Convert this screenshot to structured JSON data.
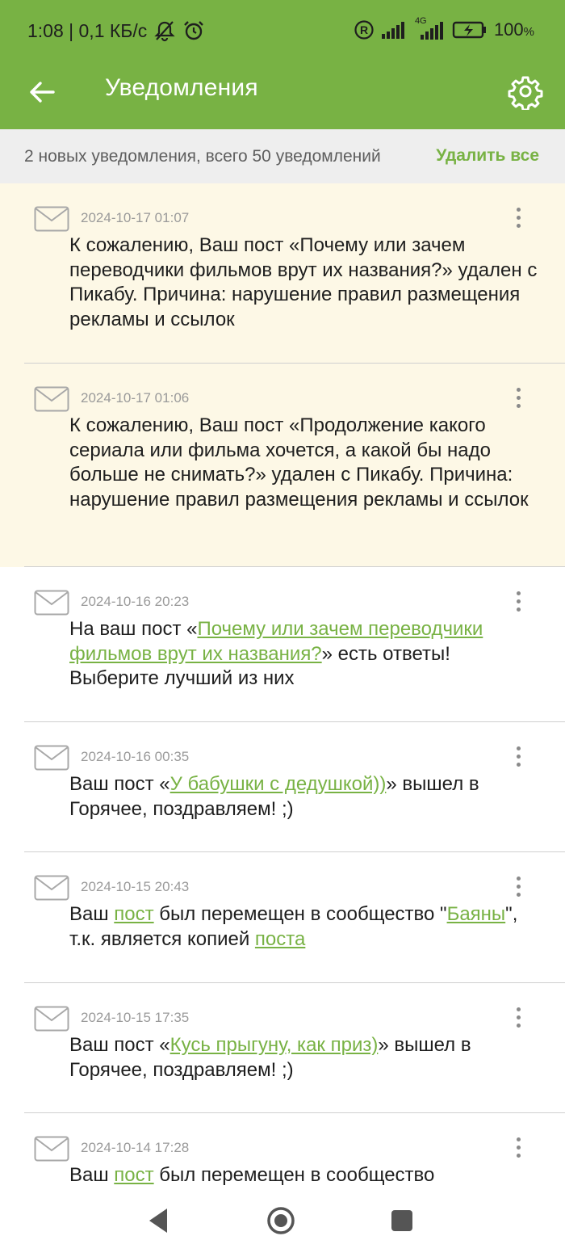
{
  "status_bar": {
    "left_text": "1:08 | 0,1 КБ/с",
    "network_label": "4G",
    "battery_percent": "100",
    "battery_unit": "%",
    "icons": [
      "muted-bell-icon",
      "alarm-icon",
      "registered-icon",
      "signal-icon",
      "signal-4g-icon",
      "battery-charging-icon"
    ]
  },
  "app_bar": {
    "title": "Уведомления",
    "icons": [
      "back-arrow-icon",
      "settings-gear-icon"
    ]
  },
  "summary": {
    "text": "2 новых уведомления, всего 50 уведомлений",
    "delete_all": "Удалить все"
  },
  "colors": {
    "brand_green": "#78b244",
    "unread_bg": "#fdf8e6",
    "summary_bg": "#eeeeee"
  },
  "notifications": [
    {
      "date": "2024-10-17 01:07",
      "unread": true,
      "text": "К сожалению, Ваш пост «Почему или зачем переводчики фильмов врут их названия?» удален с Пикабу. Причина: нарушение правил размещения рекламы и ссылок"
    },
    {
      "date": "2024-10-17 01:06",
      "unread": true,
      "text": "К сожалению, Ваш пост «Продолжение какого сериала или фильма хочется, а какой бы надо больше не снимать?» удален с Пикабу. Причина: нарушение правил размещения рекламы и ссылок"
    },
    {
      "date": "2024-10-16 20:23",
      "unread": false,
      "t1": "На ваш пост «",
      "link1": "Почему или зачем переводчики фильмов врут их названия?",
      "t2": "» есть ответы! Выберите лучший из них"
    },
    {
      "date": "2024-10-16 00:35",
      "unread": false,
      "t1": "Ваш пост «",
      "link1": "У бабушки с дедушкой))",
      "t2": "» вышел в Горячее, поздравляем! ;)"
    },
    {
      "date": "2024-10-15 20:43",
      "unread": false,
      "t1": "Ваш ",
      "link1": "пост",
      "t2": " был перемещен в сообщество \"",
      "link2": "Баяны",
      "t3": "\", т.к. является копией ",
      "link3": "поста"
    },
    {
      "date": "2024-10-15 17:35",
      "unread": false,
      "t1": "Ваш пост «",
      "link1": "Кусь прыгуну, как приз)",
      "t2": "» вышел в Горячее, поздравляем! ;)"
    },
    {
      "date": "2024-10-14 17:28",
      "unread": false,
      "t1": "Ваш ",
      "link1": "пост",
      "t2": " был перемещен в сообщество"
    }
  ],
  "nav_bar": {
    "icons": [
      "nav-back-icon",
      "nav-home-icon",
      "nav-recents-icon"
    ]
  }
}
